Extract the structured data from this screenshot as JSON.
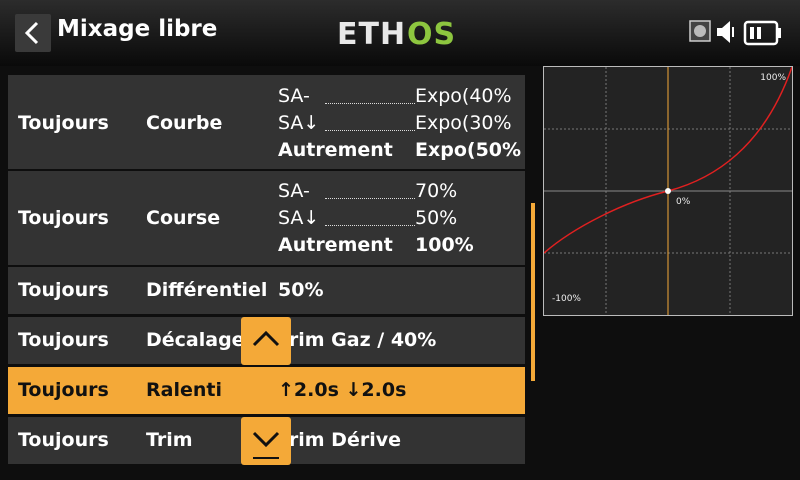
{
  "header": {
    "title": "Mixage libre",
    "logo": "ETHOS",
    "icons": [
      "back-arrow-icon",
      "record-icon",
      "speaker-icon",
      "battery-icon"
    ],
    "accent_color": "#f4a938"
  },
  "rows": [
    {
      "condition": "Toujours",
      "type": "Courbe",
      "lines": [
        {
          "switch": "SA-",
          "value": "Expo(40%"
        },
        {
          "switch": "SA↓",
          "value": "Expo(30%"
        },
        {
          "switch": "Autrement",
          "value": "Expo(50%"
        }
      ]
    },
    {
      "condition": "Toujours",
      "type": "Course",
      "lines": [
        {
          "switch": "SA-",
          "value": "70%"
        },
        {
          "switch": "SA↓",
          "value": "50%"
        },
        {
          "switch": "Autrement",
          "value": "100%"
        }
      ]
    },
    {
      "condition": "Toujours",
      "type": "Différentiel",
      "value": "50%"
    },
    {
      "condition": "Toujours",
      "type": "Décalage",
      "value": "Trim Gaz / 40%"
    },
    {
      "condition": "Toujours",
      "type": "Ralenti",
      "value": "↑2.0s ↓2.0s",
      "selected": true
    },
    {
      "condition": "Toujours",
      "type": "Trim",
      "value": "Trim Dérive"
    }
  ],
  "graph": {
    "label_max": "100%",
    "label_center": "0%",
    "label_min": "-100%"
  }
}
